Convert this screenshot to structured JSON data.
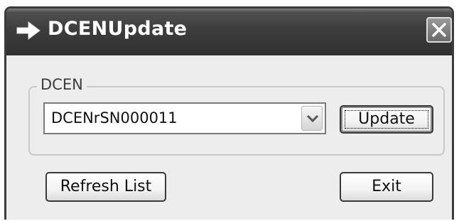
{
  "window": {
    "title": "DCENUpdate"
  },
  "titlebar": {
    "icon": "arrow-right-icon",
    "close_icon": "close-icon"
  },
  "group": {
    "label": "DCEN"
  },
  "combo": {
    "selected_value": "DCENrSN000011",
    "arrow_icon": "chevron-down-icon"
  },
  "buttons": {
    "update_label": "Update",
    "refresh_label": "Refresh List",
    "exit_label": "Exit"
  }
}
